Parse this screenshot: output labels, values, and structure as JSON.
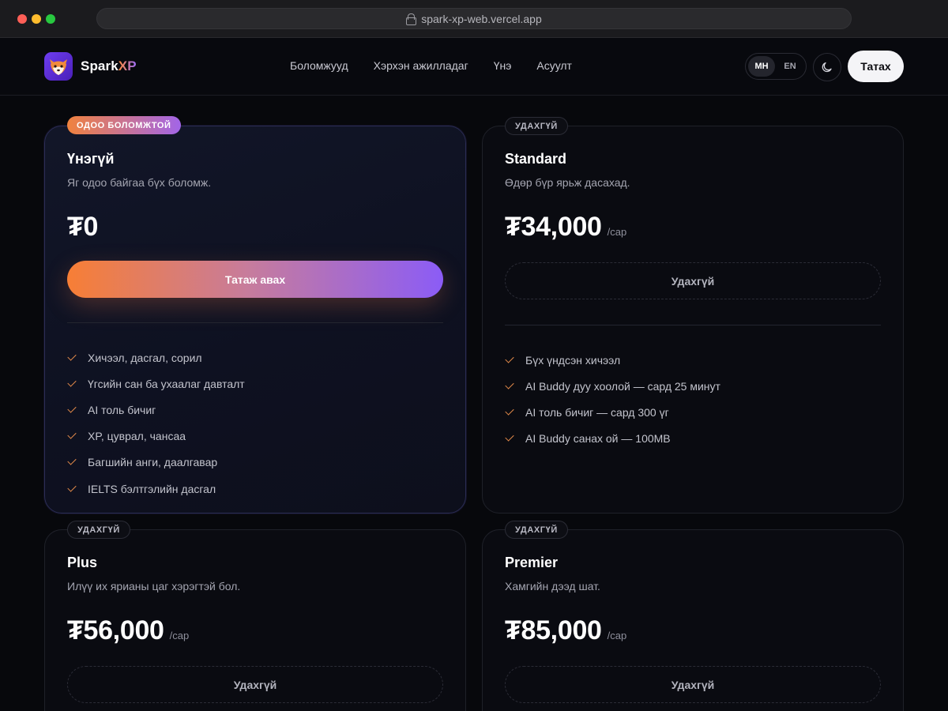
{
  "browser": {
    "url": "spark-xp-web.vercel.app"
  },
  "nav": {
    "brand_main": "Spark",
    "brand_accent": "XP",
    "links": [
      "Боломжууд",
      "Хэрхэн ажилладаг",
      "Үнэ",
      "Асуулт"
    ],
    "lang_options": [
      "MH",
      "EN"
    ],
    "lang_active": "MH",
    "download_label": "Татах"
  },
  "icons": {
    "logo": "fox-logo-icon",
    "theme": "moon-icon",
    "check": "check-icon",
    "lock": "lock-icon"
  },
  "colors": {
    "accent_orange": "#f77e35",
    "accent_purple": "#8b5cf6",
    "background": "#07080c"
  },
  "plans": [
    {
      "badge": "ОДОО БОЛОМЖТОЙ",
      "name": "Үнэгүй",
      "desc": "Яг одоо байгаа бүх боломж.",
      "price": "₮0",
      "period": "",
      "cta": "Татаж авах",
      "features": [
        "Хичээл, дасгал, сорил",
        "Үгсийн сан ба ухаалаг давталт",
        "AI толь бичиг",
        "XP, цуврал, чансаа",
        "Багшийн анги, даалгавар",
        "IELTS бэлтгэлийн дасгал"
      ]
    },
    {
      "badge": "УДАХГҮЙ",
      "name": "Standard",
      "desc": "Өдөр бүр ярьж дасахад.",
      "price": "₮34,000",
      "period": "/сар",
      "cta": "Удахгүй",
      "features": [
        "Бүх үндсэн хичээл",
        "AI Buddy дуу хоолой — сард 25 минут",
        "AI толь бичиг — сард 300 үг",
        "AI Buddy санах ой — 100MB"
      ]
    },
    {
      "badge": "УДАХГҮЙ",
      "name": "Plus",
      "desc": "Илүү их ярианы цаг хэрэгтэй бол.",
      "price": "₮56,000",
      "period": "/сар",
      "cta": "Удахгүй",
      "features": []
    },
    {
      "badge": "УДАХГҮЙ",
      "name": "Premier",
      "desc": "Хамгийн дээд шат.",
      "price": "₮85,000",
      "period": "/сар",
      "cta": "Удахгүй",
      "features": []
    }
  ]
}
